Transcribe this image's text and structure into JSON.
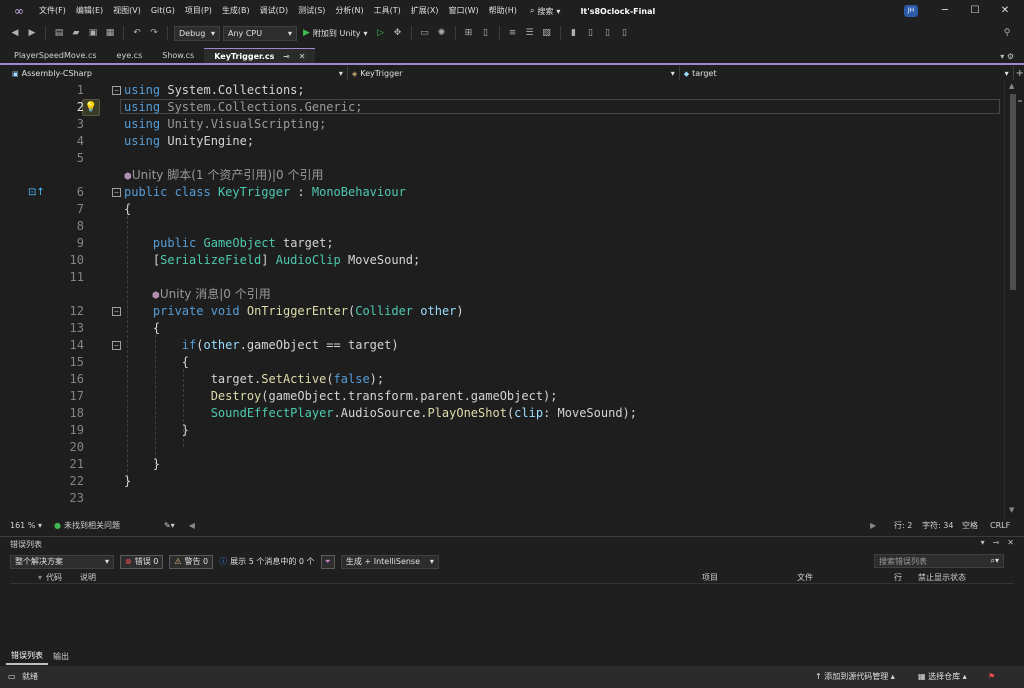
{
  "menu": [
    "文件(F)",
    "编辑(E)",
    "视图(V)",
    "Git(G)",
    "项目(P)",
    "生成(B)",
    "调试(D)",
    "测试(S)",
    "分析(N)",
    "工具(T)",
    "扩展(X)",
    "窗口(W)",
    "帮助(H)"
  ],
  "search_label": "搜索",
  "solution_name": "It's8Oclock-Final",
  "avatar_initials": "JH",
  "toolbar": {
    "config": "Debug",
    "platform": "Any CPU",
    "run_label": "附加到 Unity"
  },
  "tabs": [
    {
      "label": "PlayerSpeedMove.cs",
      "active": false
    },
    {
      "label": "eye.cs",
      "active": false
    },
    {
      "label": "Show.cs",
      "active": false
    },
    {
      "label": "KeyTrigger.cs",
      "active": true
    }
  ],
  "navbar": {
    "project": "Assembly-CSharp",
    "type": "KeyTrigger",
    "member": "target"
  },
  "codelens": {
    "line5": "Unity 脚本(1 个资产引用)|0 个引用",
    "line11": "Unity 消息|0 个引用"
  },
  "line_numbers": [
    "1",
    "2",
    "3",
    "4",
    "5",
    "6",
    "7",
    "8",
    "9",
    "10",
    "11",
    "12",
    "13",
    "14",
    "15",
    "16",
    "17",
    "18",
    "19",
    "20",
    "21",
    "22",
    "23"
  ],
  "editor_status": {
    "zoom": "161 %",
    "issues": "未找到相关问题",
    "row": "行: 2",
    "col": "字符: 34",
    "indent": "空格",
    "eol": "CRLF"
  },
  "error_list": {
    "title": "错误列表",
    "scope": "整个解决方案",
    "errors": "错误 0",
    "warnings": "警告 0",
    "messages": "展示 5 个消息中的 0 个",
    "build_filter": "生成 + IntelliSense",
    "search_placeholder": "搜索错误列表",
    "columns": {
      "code": "代码",
      "desc": "说明",
      "project": "项目",
      "file": "文件",
      "line": "行",
      "suppress": "禁止显示状态"
    }
  },
  "bottom_tabs": [
    "错误列表",
    "输出"
  ],
  "statusbar": {
    "ready": "就绪",
    "add_source": "添加到源代码管理",
    "select_repo": "选择仓库"
  }
}
